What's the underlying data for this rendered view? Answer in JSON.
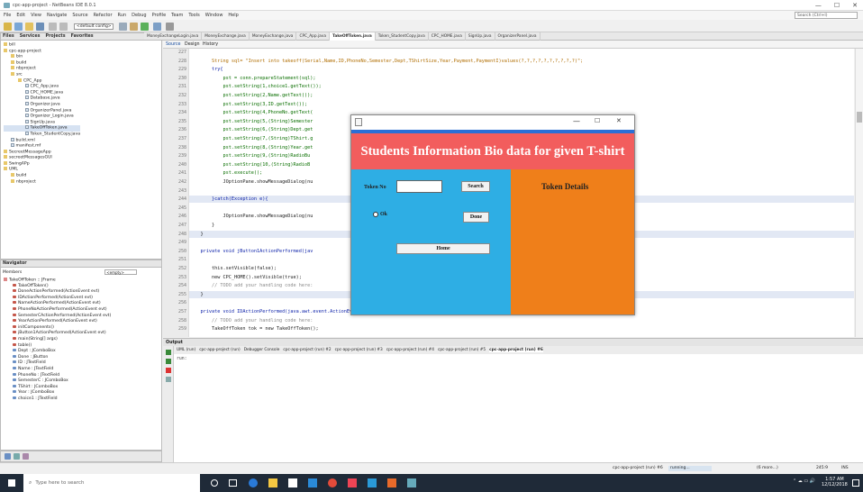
{
  "window": {
    "title": "cpc-app-project - NetBeans IDE 8.0.1",
    "minimize": "—",
    "maximize": "☐",
    "close": "✕"
  },
  "menu": [
    "File",
    "Edit",
    "View",
    "Navigate",
    "Source",
    "Refactor",
    "Run",
    "Debug",
    "Profile",
    "Team",
    "Tools",
    "Window",
    "Help"
  ],
  "search": {
    "placeholder": "Search (Ctrl+I)"
  },
  "toolbar": {
    "config": "<default config>"
  },
  "projects_panel": {
    "tabs": [
      "Files",
      "Services",
      "Projects",
      "Favorites"
    ],
    "tree": [
      {
        "label": "bill",
        "kind": "folder",
        "indent": 0
      },
      {
        "label": "cpc-app-project",
        "kind": "folder",
        "indent": 0
      },
      {
        "label": "bin",
        "kind": "folder",
        "indent": 1
      },
      {
        "label": "build",
        "kind": "folder",
        "indent": 1
      },
      {
        "label": "nbproject",
        "kind": "folder",
        "indent": 1
      },
      {
        "label": "src",
        "kind": "folder",
        "indent": 1
      },
      {
        "label": "CPC_App",
        "kind": "folder",
        "indent": 2
      },
      {
        "label": "CPC_App.java",
        "kind": "file",
        "indent": 3
      },
      {
        "label": "CPC_HOME.java",
        "kind": "file",
        "indent": 3
      },
      {
        "label": "Database.java",
        "kind": "file",
        "indent": 3
      },
      {
        "label": "Organizer.java",
        "kind": "file",
        "indent": 3
      },
      {
        "label": "OrganizerPanel.java",
        "kind": "file",
        "indent": 3
      },
      {
        "label": "Organizer_Login.java",
        "kind": "file",
        "indent": 3
      },
      {
        "label": "SignUp.java",
        "kind": "file",
        "indent": 3
      },
      {
        "label": "TakeOffToken.java",
        "kind": "file",
        "indent": 3
      },
      {
        "label": "Token_StudentCopy.java",
        "kind": "file",
        "indent": 3
      },
      {
        "label": "build.xml",
        "kind": "file",
        "indent": 1
      },
      {
        "label": "manifest.mf",
        "kind": "file",
        "indent": 1
      },
      {
        "label": "SecreetMessageApp",
        "kind": "folder",
        "indent": 0
      },
      {
        "label": "secreetMessagesGUI",
        "kind": "folder",
        "indent": 0
      },
      {
        "label": "SwingAPp",
        "kind": "folder",
        "indent": 0
      },
      {
        "label": "UML",
        "kind": "folder",
        "indent": 0
      },
      {
        "label": "build",
        "kind": "folder",
        "indent": 1
      },
      {
        "label": "nbproject",
        "kind": "folder",
        "indent": 1
      }
    ]
  },
  "navigator": {
    "title": "Navigator",
    "members_label": "Members",
    "filter": "<empty>",
    "root": "TakeOffToken :: JFrame",
    "items": [
      "TakeOffToken()",
      "DoneActionPerformed(ActionEvent evt)",
      "IDActionPerformed(ActionEvent evt)",
      "NameActionPerformed(ActionEvent evt)",
      "PhoneNoActionPerformed(ActionEvent evt)",
      "SemesterCActionPerformed(ActionEvent evt)",
      "YearActionPerformed(ActionEvent evt)",
      "initComponents()",
      "jButton1ActionPerformed(ActionEvent evt)",
      "main(String[] args)",
      "table()",
      "Dept : JComboBox",
      "Done : JButton",
      "ID : JTextField",
      "Name : JTextField",
      "PhoneNo : JTextField",
      "SemesterC : JComboBox",
      "TShirt : JComboBox",
      "Year : JComboBox",
      "choice1 : JTextField"
    ]
  },
  "editor": {
    "tabs": [
      {
        "label": "MoneyExchangeLogin.java",
        "active": false
      },
      {
        "label": "MoneyExchange.java",
        "active": false
      },
      {
        "label": "MoneyExchange.java",
        "active": false
      },
      {
        "label": "CPC_App.java",
        "active": false
      },
      {
        "label": "TakeOffToken.java",
        "active": true
      },
      {
        "label": "Token_StudentCopy.java",
        "active": false
      },
      {
        "label": "CPC_HOME.java",
        "active": false
      },
      {
        "label": "SignUp.java",
        "active": false
      },
      {
        "label": "OrganizerPanel.java",
        "active": false
      }
    ],
    "source_tab": "Source",
    "design_tab": "Design",
    "history_tab": "History",
    "line_numbers": [
      "227",
      "228",
      "229",
      "230",
      "231",
      "232",
      "233",
      "234",
      "235",
      "236",
      "237",
      "238",
      "239",
      "240",
      "241",
      "242",
      "243",
      "244",
      "245",
      "246",
      "247",
      "248",
      "249",
      "250",
      "251",
      "252",
      "253",
      "254",
      "255",
      "256",
      "257",
      "258",
      "259"
    ],
    "code": [
      "",
      "        String sql= \"Insert into takeoff(Serial,Name,ID,PhoneNo,Semester,Dept,TShirtSize,Year,Payment,PaymentI)values(?,?,?,?,?,?,?,?,?,?)\";",
      "        try{",
      "            pst = conn.prepareStatement(sql);",
      "            pst.setString(1,choice1.getText());",
      "            pst.setString(2,Name.getText());",
      "            pst.setString(3,ID.getText());",
      "            pst.setString(4,PhoneNo.getText(",
      "            pst.setString(5,(String)Semester",
      "            pst.setString(6,(String)Dept.get",
      "            pst.setString(7,(String)TShirt.g",
      "            pst.setString(8,(String)Year.get",
      "            pst.setString(9,(String)RadioBu",
      "            pst.setString(10,(String)RadioB",
      "            pst.execute();",
      "            JOptionPane.showMessageDialog(nu",
      "",
      "        }catch(Exception e){",
      "",
      "            JOptionPane.showMessageDialog(nu",
      "        }",
      "    }",
      "",
      "    private void jButton1ActionPerformed(jav",
      "",
      "        this.setVisible(false);",
      "        new CPC_HOME().setVisible(true);",
      "        // TODO add your handling code here:",
      "    }",
      "",
      "    private void IDActionPerformed(java.awt.event.ActionEvent evt) {",
      "        // TODO add your handling code here:",
      "        TakeOffToken tok = new TakeOffToken();"
    ]
  },
  "output": {
    "title": "Output",
    "tabs": [
      "UML (run)",
      "cpc-app-project (run)",
      "Debugger Console",
      "cpc-app-project (run) #2",
      "cpc-app-project (run) #3",
      "cpc-app-project (run) #4",
      "cpc-app-project (run) #5",
      "cpc-app-project (run) #6"
    ],
    "first_line": "run:"
  },
  "statusbar": {
    "project": "cpc-app-project (run) #6",
    "state": "running...",
    "more": "(6 more...)",
    "pos": "245:9",
    "mode": "INS"
  },
  "taskbar": {
    "search": "Type here to search",
    "time": "1:57 AM",
    "date": "12/12/2018"
  },
  "dialog": {
    "title_icon": "java-icon",
    "minimize": "—",
    "maximize": "☐",
    "close": "✕",
    "header": "Students Information Bio data for given T-shirt",
    "token_label": "Token No",
    "token_value": "",
    "search_label": "Search",
    "ok_label": "Ok",
    "done_label": "Done",
    "home_label": "Home",
    "details_title": "Token Details",
    "colors": {
      "header": "#f25d5d",
      "left": "#2eaee4",
      "right": "#ef7f1a"
    }
  }
}
